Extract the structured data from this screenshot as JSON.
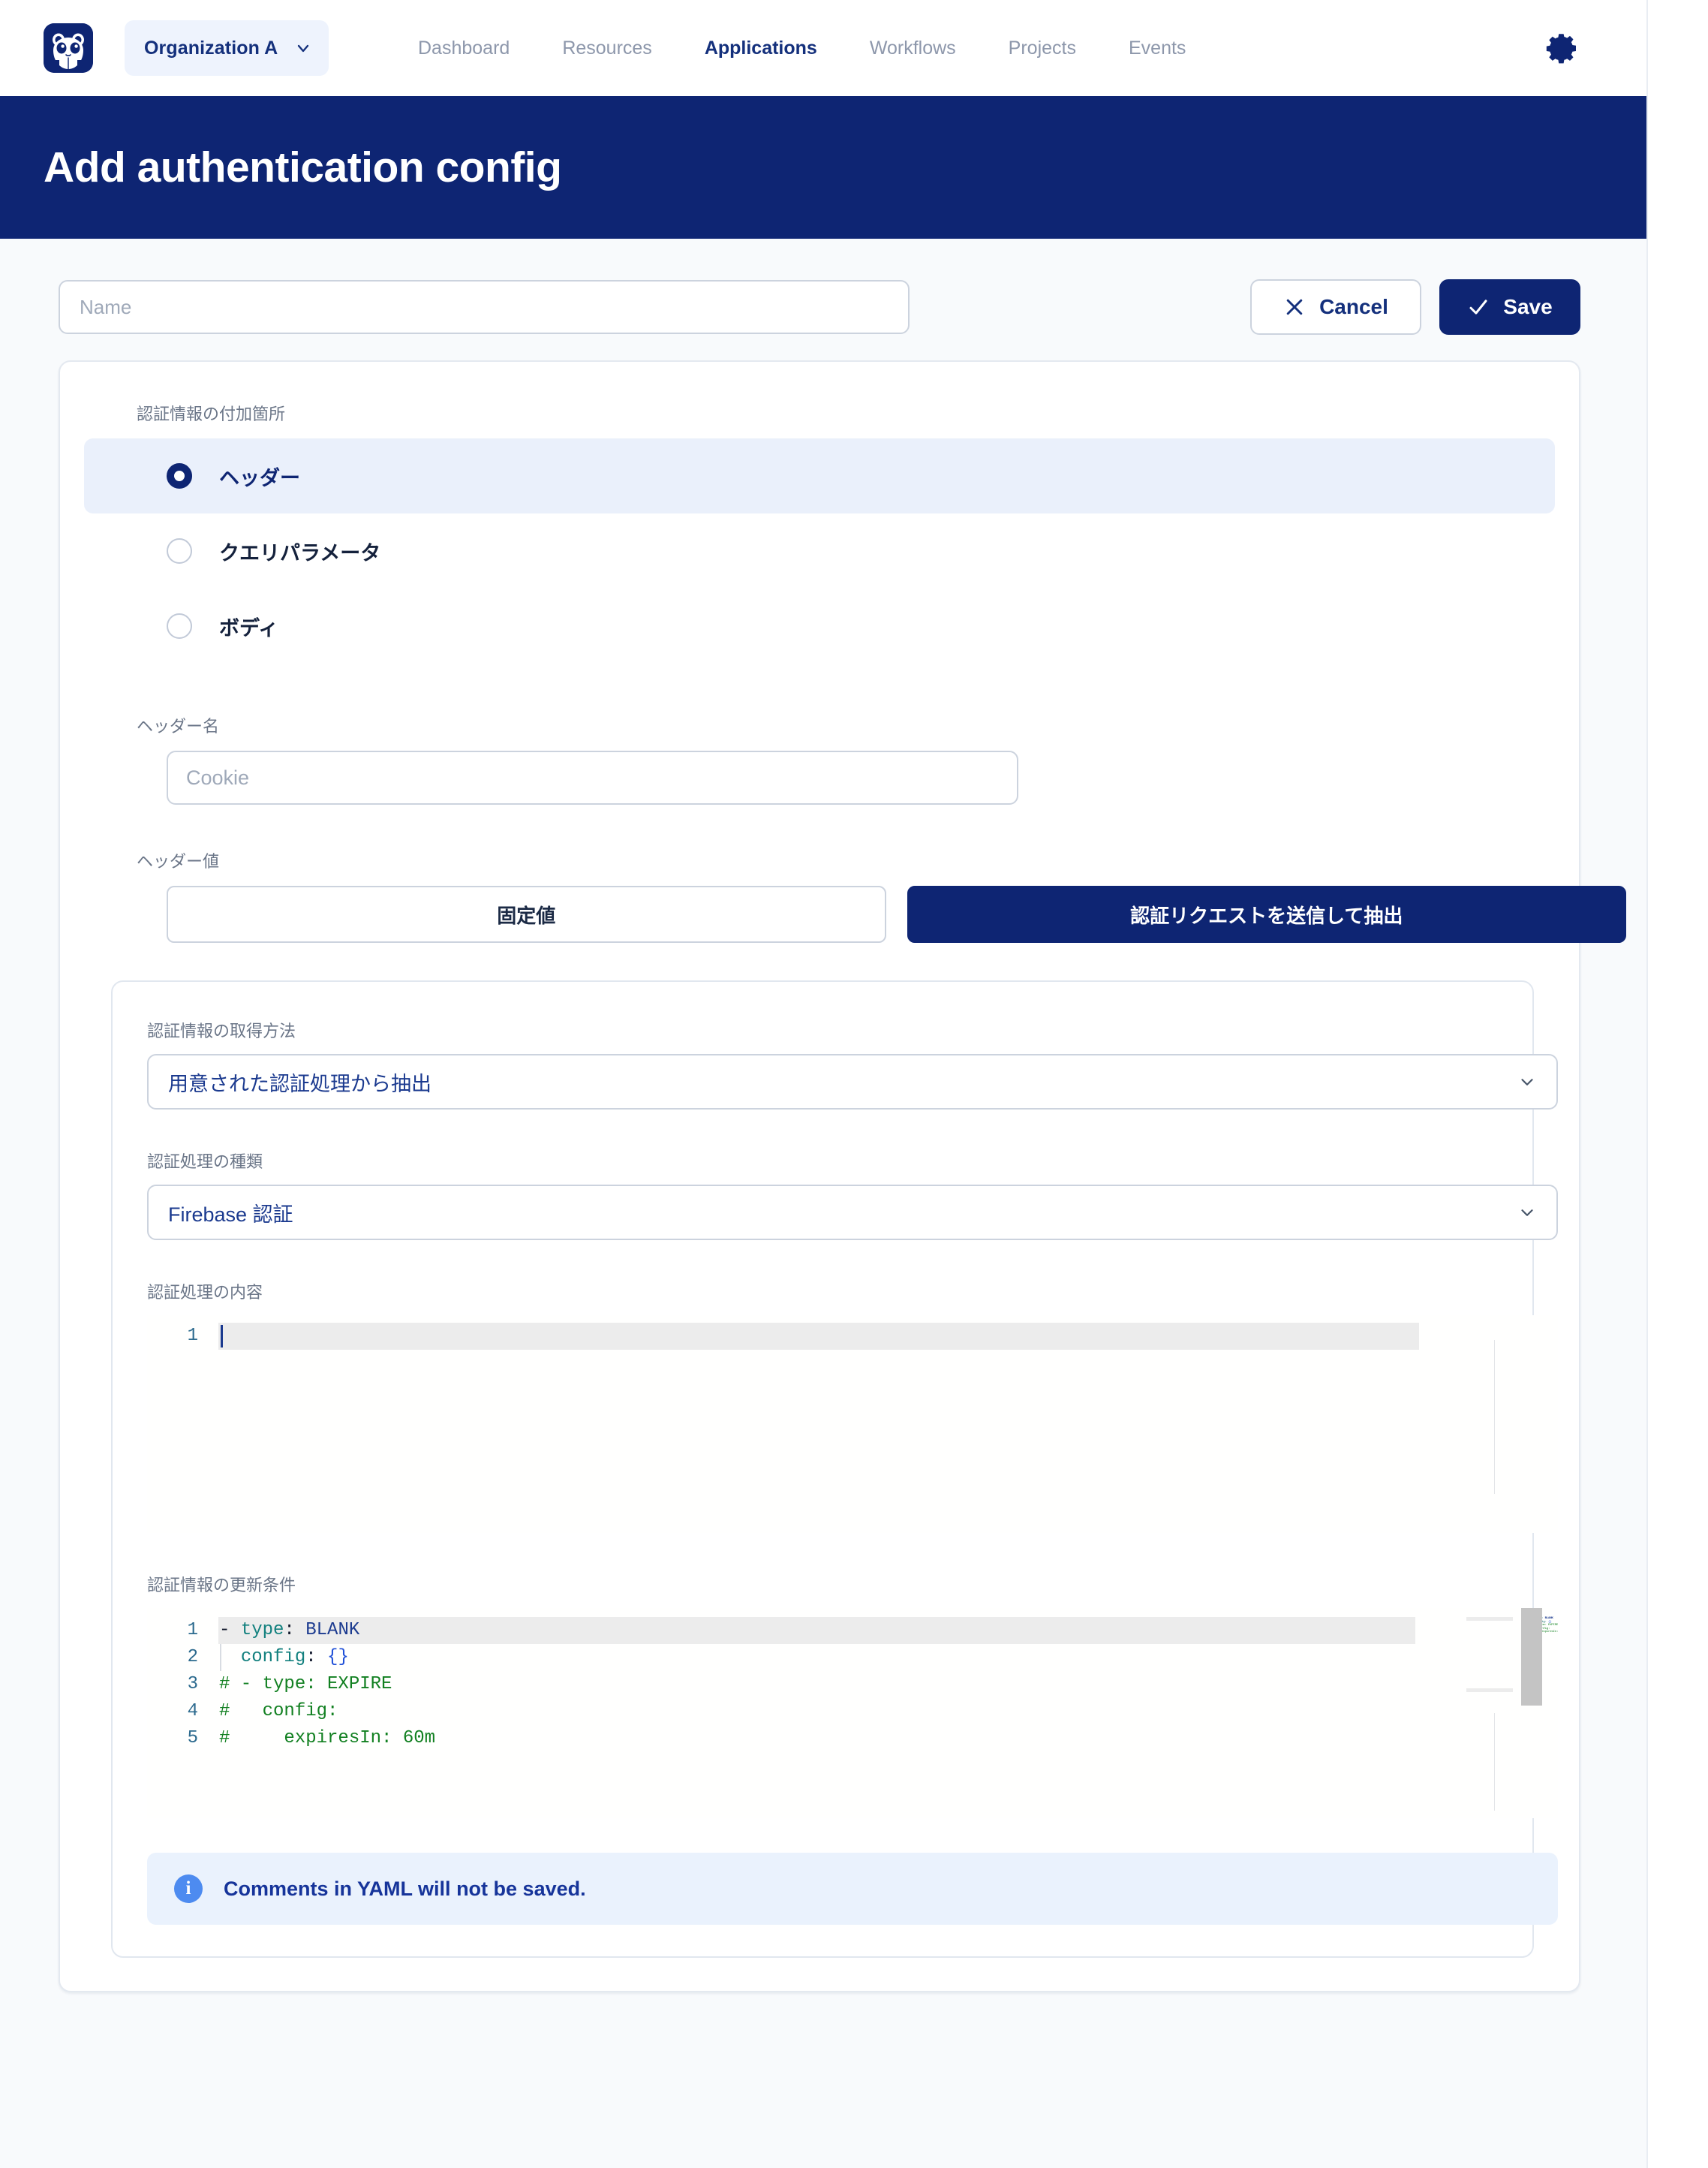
{
  "colors": {
    "brand_navy": "#0e2573",
    "accent_blue": "#1b3a8f",
    "panel_bg": "#f8fafc",
    "radio_selected_bg": "#eaf0fb",
    "info_bg": "#eaf2fd",
    "info_icon": "#4d8bf0",
    "yaml_key": "#12807e",
    "yaml_value": "#1b3a8f",
    "yaml_comment": "#128021",
    "yaml_brace": "#1f4fd8"
  },
  "topnav": {
    "logo_icon": "panda-logo-icon",
    "org_selector": {
      "value": "Organization A",
      "chevron_icon": "chevron-down-icon"
    },
    "links": [
      {
        "label": "Dashboard",
        "active": false
      },
      {
        "label": "Resources",
        "active": false
      },
      {
        "label": "Applications",
        "active": true
      },
      {
        "label": "Workflows",
        "active": false
      },
      {
        "label": "Projects",
        "active": false
      },
      {
        "label": "Events",
        "active": false
      }
    ],
    "settings_icon": "gear-icon"
  },
  "header": {
    "title": "Add authentication config"
  },
  "actions": {
    "name_placeholder": "Name",
    "name_value": "",
    "cancel_label": "Cancel",
    "cancel_icon": "close-icon",
    "save_label": "Save",
    "save_icon": "check-icon"
  },
  "form": {
    "attach_location": {
      "label": "認証情報の付加箇所",
      "options": [
        {
          "label": "ヘッダー",
          "selected": true
        },
        {
          "label": "クエリパラメータ",
          "selected": false
        },
        {
          "label": "ボディ",
          "selected": false
        }
      ]
    },
    "header_name": {
      "label": "ヘッダー名",
      "placeholder": "Cookie",
      "value": ""
    },
    "header_value": {
      "label": "ヘッダー値",
      "segments": [
        {
          "label": "固定値",
          "selected": false
        },
        {
          "label": "認証リクエストを送信して抽出",
          "selected": true
        }
      ]
    },
    "credential_method": {
      "label": "認証情報の取得方法",
      "value": "用意された認証処理から抽出",
      "chevron_icon": "chevron-down-icon"
    },
    "auth_process_type": {
      "label": "認証処理の種類",
      "value": "Firebase 認証",
      "chevron_icon": "chevron-down-icon"
    },
    "auth_process_content": {
      "label": "認証処理の内容",
      "lines": [
        {
          "no": "1",
          "text": ""
        }
      ]
    },
    "refresh_condition": {
      "label": "認証情報の更新条件",
      "lines": [
        {
          "no": "1",
          "text": "- type: BLANK"
        },
        {
          "no": "2",
          "text": "  config: {}"
        },
        {
          "no": "3",
          "text": "# - type: EXPIRE"
        },
        {
          "no": "4",
          "text": "#   config:"
        },
        {
          "no": "5",
          "text": "#     expiresIn: 60m"
        }
      ]
    },
    "info_banner": {
      "icon": "info-icon",
      "text": "Comments in YAML will not be saved."
    }
  }
}
